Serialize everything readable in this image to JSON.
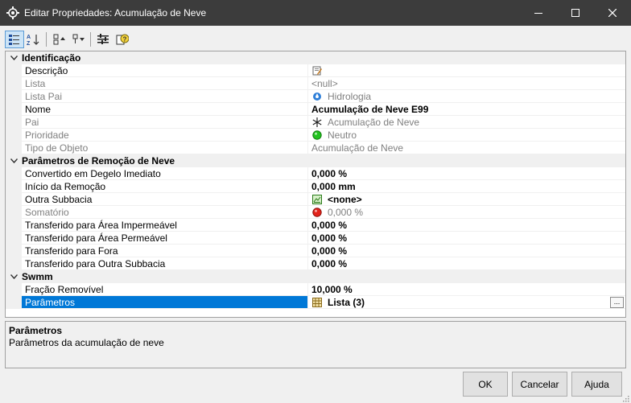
{
  "window": {
    "title": "Editar Propriedades: Acumulação de Neve"
  },
  "toolbar": {
    "buttons": [
      {
        "icon": "categorized-icon"
      },
      {
        "icon": "alphabetical-sort-icon"
      },
      {
        "icon": "collapse-all-icon"
      },
      {
        "icon": "expand-all-icon"
      },
      {
        "icon": "property-pages-icon"
      },
      {
        "icon": "help-icon"
      }
    ]
  },
  "grid": {
    "categories": [
      {
        "label": "Identificação",
        "rows": [
          {
            "name": "Descrição",
            "value": "",
            "icon": "edit-note-icon"
          },
          {
            "name": "Lista",
            "value": "<null>"
          },
          {
            "name": "Lista Pai",
            "value": "Hidrologia",
            "icon": "hydrology-icon"
          },
          {
            "name": "Nome",
            "value": "Acumulação de Neve E99"
          },
          {
            "name": "Pai",
            "value": "Acumulação de Neve",
            "icon": "snowflake-icon"
          },
          {
            "name": "Prioridade",
            "value": "Neutro",
            "icon": "green-dot-icon"
          },
          {
            "name": "Tipo de Objeto",
            "value": "Acumulação de Neve"
          }
        ]
      },
      {
        "label": "Parâmetros de Remoção de Neve",
        "rows": [
          {
            "name": "Convertido em Degelo Imediato",
            "value": "0,000 %"
          },
          {
            "name": "Início da Remoção",
            "value": "0,000 mm"
          },
          {
            "name": "Outra Subbacia",
            "value": "<none>",
            "icon": "subbasin-icon"
          },
          {
            "name": "Somatório",
            "value": "0,000 %",
            "icon": "red-dot-icon"
          },
          {
            "name": "Transferido para Área Impermeável",
            "value": "0,000 %"
          },
          {
            "name": "Transferido para Área Permeável",
            "value": "0,000 %"
          },
          {
            "name": "Transferido para Fora",
            "value": "0,000 %"
          },
          {
            "name": "Transferido para Outra Subbacia",
            "value": "0,000 %"
          }
        ]
      },
      {
        "label": "Swmm",
        "rows": [
          {
            "name": "Fração Removível",
            "value": "10,000 %"
          },
          {
            "name": "Parâmetros",
            "value": "Lista (3)",
            "icon": "table-icon",
            "ellipsis": "..."
          }
        ]
      }
    ]
  },
  "description": {
    "title": "Parâmetros",
    "text": "Parâmetros da acumulação de neve"
  },
  "buttons": {
    "ok": "OK",
    "cancel": "Cancelar",
    "help": "Ajuda"
  },
  "colors": {
    "selection": "#0078d7",
    "titlebar": "#3c3c3c"
  }
}
